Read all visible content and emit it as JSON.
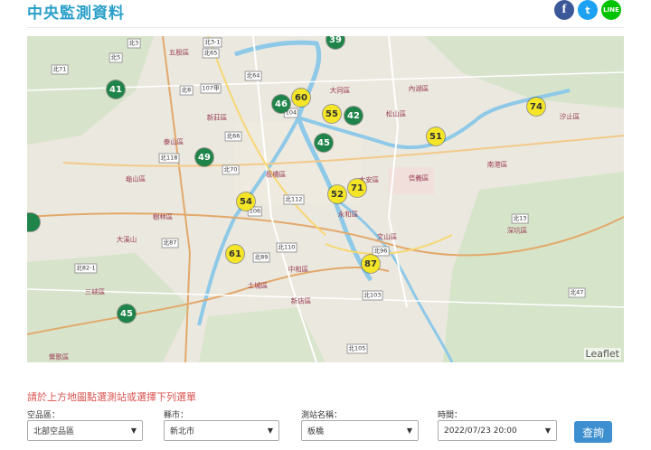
{
  "header": {
    "title": "中央監測資料",
    "social": {
      "facebook": "f",
      "twitter": "t",
      "line": "LINE"
    }
  },
  "map": {
    "attribution": "Leaflet",
    "stations": [
      {
        "value": "39",
        "level": "good"
      },
      {
        "value": "41",
        "level": "good"
      },
      {
        "value": "46",
        "level": "good"
      },
      {
        "value": "60",
        "level": "moderate"
      },
      {
        "value": "55",
        "level": "moderate"
      },
      {
        "value": "42",
        "level": "good"
      },
      {
        "value": "74",
        "level": "moderate"
      },
      {
        "value": "45",
        "level": "good"
      },
      {
        "value": "51",
        "level": "moderate"
      },
      {
        "value": "49",
        "level": "good"
      },
      {
        "value": "54",
        "level": "moderate"
      },
      {
        "value": "52",
        "level": "moderate"
      },
      {
        "value": "71",
        "level": "moderate"
      },
      {
        "value": "61",
        "level": "moderate"
      },
      {
        "value": "87",
        "level": "moderate"
      },
      {
        "value": "45",
        "level": "good"
      }
    ],
    "places": [
      "五股區",
      "泰山區",
      "龜山區",
      "板橋區",
      "新莊區",
      "大安區",
      "信義區",
      "南港區",
      "中和區",
      "永和區",
      "土城區",
      "新店區",
      "樹林區",
      "三峽區",
      "大溪山",
      "鶯歌區",
      "文山區",
      "深坑區",
      "大同區",
      "松山區",
      "內湖區",
      "汐止區"
    ],
    "roads": [
      "北5",
      "北3-1",
      "北65",
      "107甲",
      "北64",
      "104",
      "北71",
      "106",
      "北66",
      "北118",
      "北70",
      "北112",
      "北87",
      "北89",
      "北110",
      "北103",
      "北105",
      "北96",
      "北47",
      "北82-1",
      "北3",
      "北8",
      "北13"
    ]
  },
  "form": {
    "hint": "請於上方地圖點選測站或選擇下列選單",
    "region_label": "空品區：",
    "region_value": "北部空品區",
    "city_label": "縣市：",
    "city_value": "新北市",
    "station_label": "測站名稱：",
    "station_value": "板橋",
    "time_label": "時間：",
    "time_value": "2022/07/23 20:00",
    "submit": "查詢"
  }
}
